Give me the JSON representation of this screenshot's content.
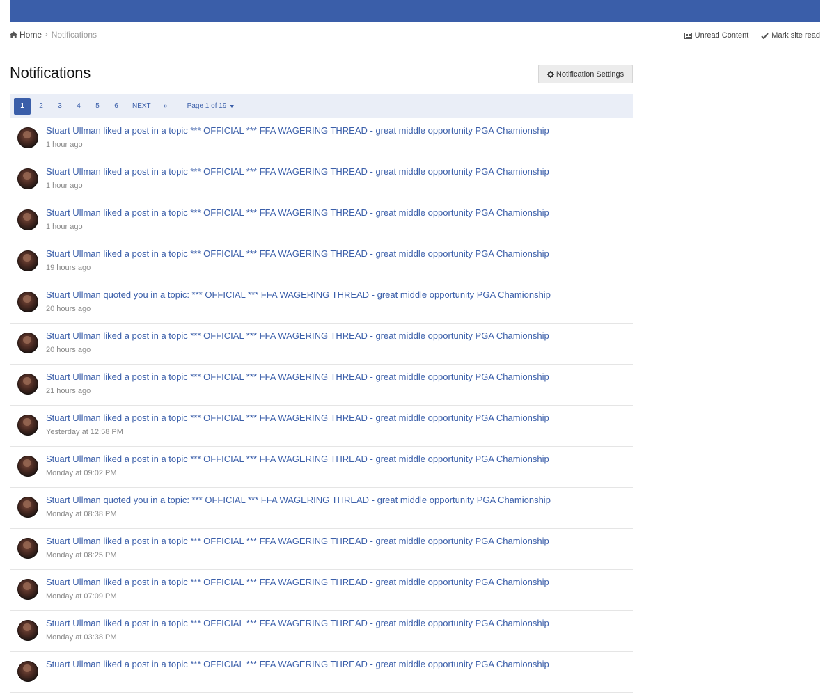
{
  "breadcrumb": {
    "home": "Home",
    "current": "Notifications"
  },
  "quicklinks": {
    "unread": "Unread Content",
    "mark_read": "Mark site read"
  },
  "page": {
    "title": "Notifications",
    "settings_button": "Notification Settings"
  },
  "pagination": {
    "pages": [
      "1",
      "2",
      "3",
      "4",
      "5",
      "6"
    ],
    "active": "1",
    "next": "NEXT",
    "last": "»",
    "jump": "Page 1 of 19"
  },
  "colors": {
    "brand": "#3a5ea9",
    "pager_bg": "#eaeef7"
  },
  "notifications": [
    {
      "text": "Stuart Ullman liked a post in a topic *** OFFICIAL *** FFA WAGERING THREAD - great middle opportunity PGA Chamionship",
      "time": "1 hour ago"
    },
    {
      "text": "Stuart Ullman liked a post in a topic *** OFFICIAL *** FFA WAGERING THREAD - great middle opportunity PGA Chamionship",
      "time": "1 hour ago"
    },
    {
      "text": "Stuart Ullman liked a post in a topic *** OFFICIAL *** FFA WAGERING THREAD - great middle opportunity PGA Chamionship",
      "time": "1 hour ago"
    },
    {
      "text": "Stuart Ullman liked a post in a topic *** OFFICIAL *** FFA WAGERING THREAD - great middle opportunity PGA Chamionship",
      "time": "19 hours ago"
    },
    {
      "text": "Stuart Ullman quoted you in a topic: *** OFFICIAL *** FFA WAGERING THREAD - great middle opportunity PGA Chamionship",
      "time": "20 hours ago"
    },
    {
      "text": "Stuart Ullman liked a post in a topic *** OFFICIAL *** FFA WAGERING THREAD - great middle opportunity PGA Chamionship",
      "time": "20 hours ago"
    },
    {
      "text": "Stuart Ullman liked a post in a topic *** OFFICIAL *** FFA WAGERING THREAD - great middle opportunity PGA Chamionship",
      "time": "21 hours ago"
    },
    {
      "text": "Stuart Ullman liked a post in a topic *** OFFICIAL *** FFA WAGERING THREAD - great middle opportunity PGA Chamionship",
      "time": "Yesterday at 12:58 PM"
    },
    {
      "text": "Stuart Ullman liked a post in a topic *** OFFICIAL *** FFA WAGERING THREAD - great middle opportunity PGA Chamionship",
      "time": "Monday at 09:02 PM"
    },
    {
      "text": "Stuart Ullman quoted you in a topic: *** OFFICIAL *** FFA WAGERING THREAD - great middle opportunity PGA Chamionship",
      "time": "Monday at 08:38 PM"
    },
    {
      "text": "Stuart Ullman liked a post in a topic *** OFFICIAL *** FFA WAGERING THREAD - great middle opportunity PGA Chamionship",
      "time": "Monday at 08:25 PM"
    },
    {
      "text": "Stuart Ullman liked a post in a topic *** OFFICIAL *** FFA WAGERING THREAD - great middle opportunity PGA Chamionship",
      "time": "Monday at 07:09 PM"
    },
    {
      "text": "Stuart Ullman liked a post in a topic *** OFFICIAL *** FFA WAGERING THREAD - great middle opportunity PGA Chamionship",
      "time": "Monday at 03:38 PM"
    },
    {
      "text": "Stuart Ullman liked a post in a topic *** OFFICIAL *** FFA WAGERING THREAD - great middle opportunity PGA Chamionship",
      "time": ""
    }
  ]
}
